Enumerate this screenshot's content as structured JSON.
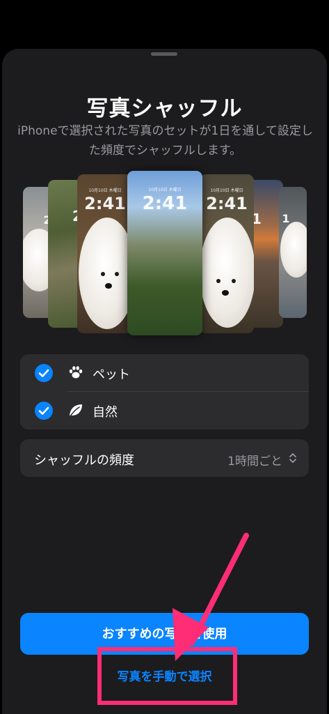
{
  "sheet": {
    "title": "写真シャッフル",
    "description": "iPhoneで選択された写真のセットが1日を通して設定した頻度でシャッフルします。"
  },
  "preview": {
    "clock_time": "2:41",
    "clock_partial_left": "2",
    "clock_partial_right": "1",
    "clock_partial_far_right": "1",
    "date_text": "10月10日 木曜日"
  },
  "options": [
    {
      "label": "ペット",
      "checked": true,
      "icon": "paw-icon"
    },
    {
      "label": "自然",
      "checked": true,
      "icon": "leaf-icon"
    }
  ],
  "frequency": {
    "label": "シャッフルの頻度",
    "value": "1時間ごと"
  },
  "buttons": {
    "primary_label": "おすすめの写真を使用",
    "secondary_label": "写真を手動で選択"
  },
  "colors": {
    "accent": "#0a84ff",
    "sheet_background": "#1c1c1e",
    "cell_background": "#2c2c2e",
    "annotation": "#ff2d75"
  }
}
